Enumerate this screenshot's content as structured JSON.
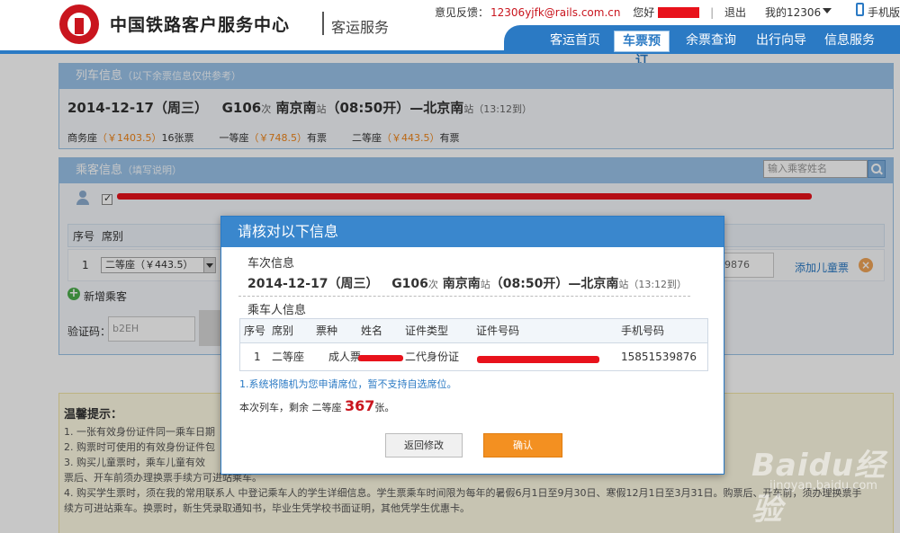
{
  "header": {
    "logo_text": "中国铁路客户服务中心",
    "logo_sub": "客运服务",
    "feedback_label": "意见反馈：",
    "feedback_email": "12306yjfk@rails.com.cn",
    "hello": "您好",
    "logout": "退出",
    "my12306": "我的12306",
    "mobile": "手机版",
    "nav": [
      "客运首页",
      "车票预订",
      "余票查询",
      "出行向导",
      "信息服务"
    ],
    "nav_active": "车票预订"
  },
  "train_panel": {
    "title": "列车信息",
    "note": "（以下余票信息仅供参考）",
    "date": "2014-12-17（周三）",
    "train_no": "G106",
    "train_suffix": "次",
    "from": "南京南",
    "from_suffix": "站",
    "depart": "（08:50开）",
    "dash": "—",
    "to": "北京南",
    "to_suffix": "站",
    "arrive": "（13:12到）",
    "seats": [
      {
        "name": "商务座",
        "price": "（￥1403.5）",
        "avail": "16张票"
      },
      {
        "name": "一等座",
        "price": "（￥748.5）",
        "avail": "有票"
      },
      {
        "name": "二等座",
        "price": "（￥443.5）",
        "avail": "有票"
      }
    ]
  },
  "passenger_panel": {
    "title": "乘客信息",
    "note": "（填写说明）",
    "search_placeholder": "输入乘客姓名",
    "col_no": "序号",
    "col_seat": "席别",
    "row_no": "1",
    "seat_value": "二等座（￥443.5）",
    "id_tail": "9876",
    "add_child": "添加儿童票",
    "add_passenger": "新增乘客",
    "captcha_label": "验证码：",
    "captcha_value": "b2EH"
  },
  "tips": {
    "title": "温馨提示：",
    "lines": [
      "1. 一张有效身份证件同一乘车日期",
      "2. 购票时可使用的有效身份证件包",
      "3. 购买儿童票时，乘车儿童有效",
      "票后、开车前须办理换票手续方可进站乘车。",
      "4. 购买学生票时，须在我的常用联系人 中登记乘车人的学生详细信息。学生票乘车时间限为每年的暑假6月1日至9月30日、寒假12月1日至3月31日。购票后、开车前，须办理换票手",
      "续方可进站乘车。换票时，新生凭录取通知书，毕业生凭学校书面证明，其他凭学生优惠卡。"
    ],
    "link": "我的常用联系人"
  },
  "modal": {
    "title": "请核对以下信息",
    "train_section": "车次信息",
    "passenger_section": "乘车人信息",
    "cols": [
      "序号",
      "席别",
      "票种",
      "姓名",
      "证件类型",
      "证件号码",
      "手机号码"
    ],
    "row": {
      "no": "1",
      "seat": "二等座",
      "ticket_type": "成人票",
      "id_type": "二代身份证",
      "phone": "15851539876"
    },
    "notice": "1.系统将随机为您申请席位，暂不支持自选席位。",
    "remain_prefix": "本次列车，剩余 二等座",
    "remain_num": "367",
    "remain_suffix": "张。",
    "btn_back": "返回修改",
    "btn_ok": "确认"
  },
  "watermark": {
    "brand": "Baidu经验",
    "sub": "jingyan.baidu.com"
  },
  "colors": {
    "brand_blue": "#2b7ac4",
    "price_orange": "#f08519",
    "confirm_orange": "#f39021",
    "logo_red": "#c9151e"
  }
}
